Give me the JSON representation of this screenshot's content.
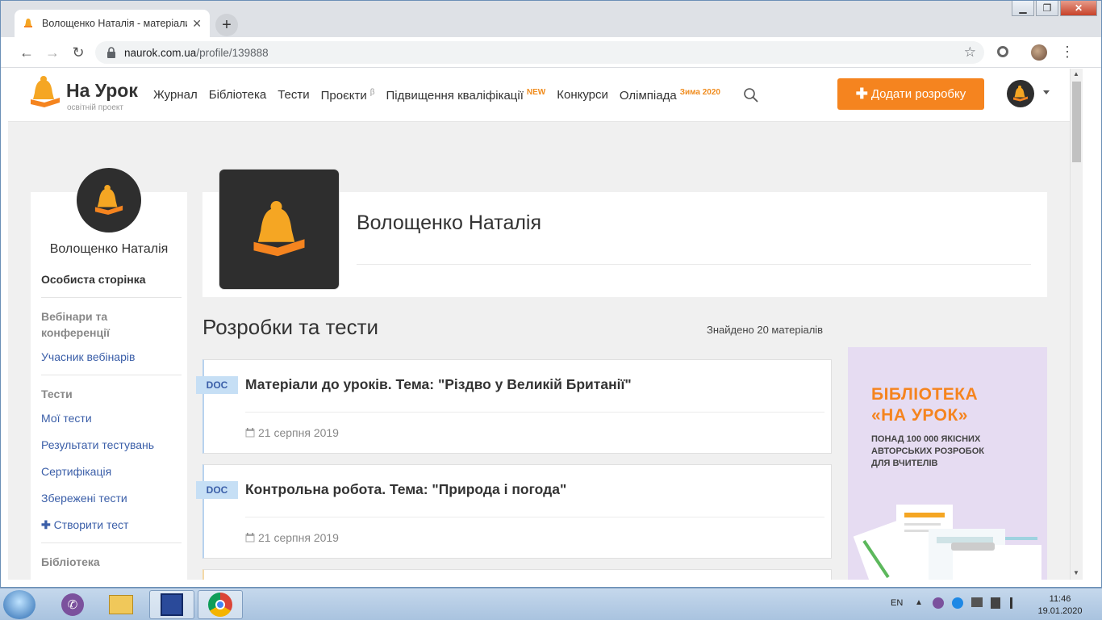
{
  "browser": {
    "tab_title": "Волощенко Наталія - матеріали",
    "url_domain": "naurok.com.ua",
    "url_path": "/profile/139888"
  },
  "header": {
    "brand": "На Урок",
    "brand_sub": "освітній проект",
    "nav": [
      {
        "label": "Журнал"
      },
      {
        "label": "Бібліотека"
      },
      {
        "label": "Тести"
      },
      {
        "label": "Проєкти",
        "sup": "β"
      },
      {
        "label": "Підвищення кваліфікації",
        "sup": "NEW"
      },
      {
        "label": "Конкурси"
      },
      {
        "label": "Олімпіада",
        "sup": "Зима 2020"
      }
    ],
    "add_button": "Додати розробку",
    "accent_color": "#f5841f"
  },
  "sidebar": {
    "name": "Волощенко Наталія",
    "personal_page": "Особиста сторінка",
    "section_webinars": "Вебінари та конференції",
    "webinar_participant": "Учасник вебінарів",
    "section_tests": "Тести",
    "my_tests": "Мої тести",
    "test_results": "Результати тестувань",
    "certification": "Сертифікація",
    "saved_tests": "Збережені тести",
    "create_test": "Створити тест",
    "section_library": "Бібліотека"
  },
  "profile": {
    "name": "Волощенко Наталія"
  },
  "materials": {
    "title": "Розробки та тести",
    "found": "Знайдено 20 матеріалів",
    "items": [
      {
        "type": "DOC",
        "title": "Матеріали до уроків. Тема: \"Різдво у Великій Британії\"",
        "date": "21 серпня 2019"
      },
      {
        "type": "DOC",
        "title": "Контрольна робота. Тема: \"Природа і погода\"",
        "date": "21 серпня 2019"
      }
    ]
  },
  "ad": {
    "title_line1": "БІБЛІОТЕКА",
    "title_line2": "«НА УРОК»",
    "sub_line1": "ПОНАД 100 000 ЯКІСНИХ",
    "sub_line2": "АВТОРСЬКИХ РОЗРОБОК",
    "sub_line3": "ДЛЯ ВЧИТЕЛІВ"
  },
  "taskbar": {
    "lang": "EN",
    "time": "11:46",
    "date": "19.01.2020"
  }
}
